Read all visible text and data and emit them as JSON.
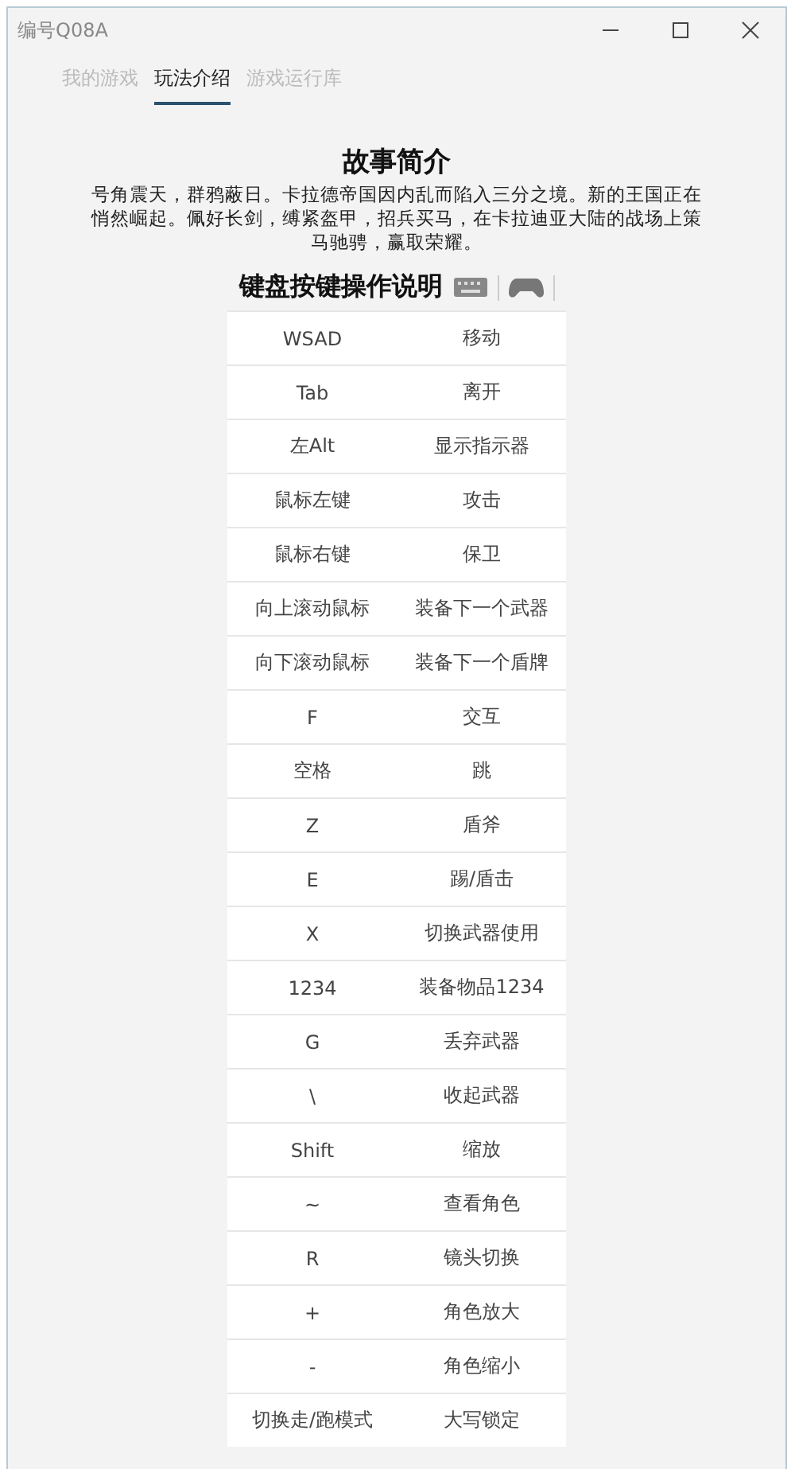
{
  "window": {
    "title": "编号Q08A"
  },
  "tabs": [
    {
      "label": "我的游戏",
      "selected": false
    },
    {
      "label": "玩法介绍",
      "selected": true
    },
    {
      "label": "游戏运行库",
      "selected": false
    }
  ],
  "story": {
    "heading": "故事简介",
    "text": "号角震天，群鸦蔽日。卡拉德帝国因内乱而陷入三分之境。新的王国正在悄然崛起。佩好长剑，缚紧盔甲，招兵买马，在卡拉迪亚大陆的战场上策马驰骋，赢取荣耀。"
  },
  "controls": {
    "heading": "键盘按键操作说明",
    "rows": [
      {
        "key": "WSAD",
        "action": "移动"
      },
      {
        "key": "Tab",
        "action": "离开"
      },
      {
        "key": "左Alt",
        "action": "显示指示器"
      },
      {
        "key": "鼠标左键",
        "action": "攻击"
      },
      {
        "key": "鼠标右键",
        "action": "保卫"
      },
      {
        "key": "向上滚动鼠标",
        "action": "装备下一个武器"
      },
      {
        "key": "向下滚动鼠标",
        "action": "装备下一个盾牌"
      },
      {
        "key": "F",
        "action": "交互"
      },
      {
        "key": "空格",
        "action": "跳"
      },
      {
        "key": "Z",
        "action": "盾斧"
      },
      {
        "key": "E",
        "action": "踢/盾击"
      },
      {
        "key": "X",
        "action": "切换武器使用"
      },
      {
        "key": "1234",
        "action": "装备物品1234"
      },
      {
        "key": "G",
        "action": "丢弃武器"
      },
      {
        "key": "\\",
        "action": "收起武器"
      },
      {
        "key": "Shift",
        "action": "缩放"
      },
      {
        "key": "~",
        "action": "查看角色"
      },
      {
        "key": "R",
        "action": "镜头切换"
      },
      {
        "key": "+",
        "action": "角色放大"
      },
      {
        "key": "-",
        "action": "角色缩小"
      },
      {
        "key": "切换走/跑模式",
        "action": "大写锁定"
      }
    ]
  }
}
